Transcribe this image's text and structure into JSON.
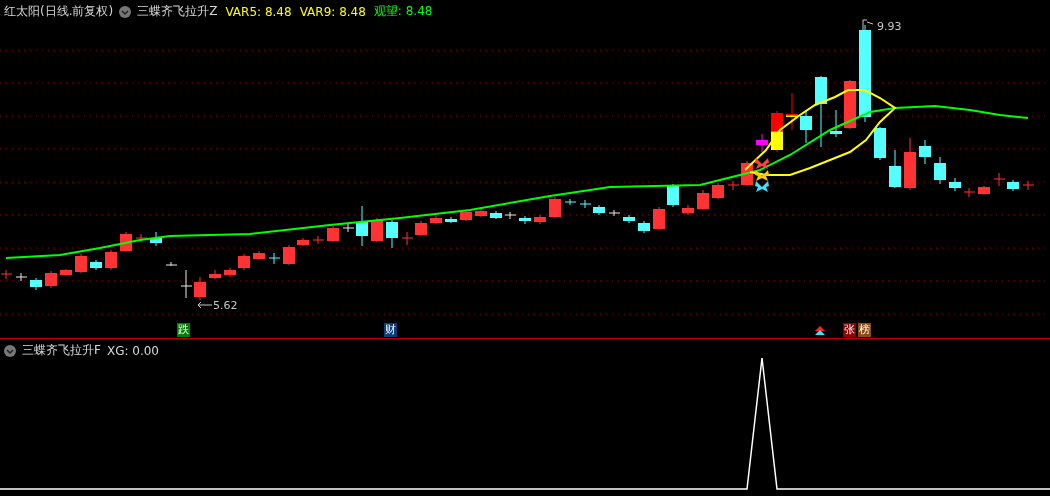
{
  "main_pane": {
    "stock_title": "红太阳(日线.前复权)",
    "indicator_name": "三蝶齐飞拉升Z",
    "readings": [
      {
        "label": "VAR5:",
        "value": "8.48",
        "color": "#ffff00"
      },
      {
        "label": "VAR9:",
        "value": "8.48",
        "color": "#ffff00"
      },
      {
        "label": "观望:",
        "value": "8.48",
        "color": "#00ff00"
      }
    ],
    "high_marker": "9.93",
    "low_marker": "5.62",
    "signals": [
      {
        "label": "跌",
        "color": "#008000"
      },
      {
        "label": "财",
        "color": "#0b3d78"
      },
      {
        "label": "张",
        "color": "#8b0000"
      },
      {
        "label": "榜",
        "color": "#8b4a10"
      }
    ]
  },
  "sub_pane": {
    "indicator_name": "三蝶齐飞拉升F",
    "reading": "XG: 0.00"
  }
}
